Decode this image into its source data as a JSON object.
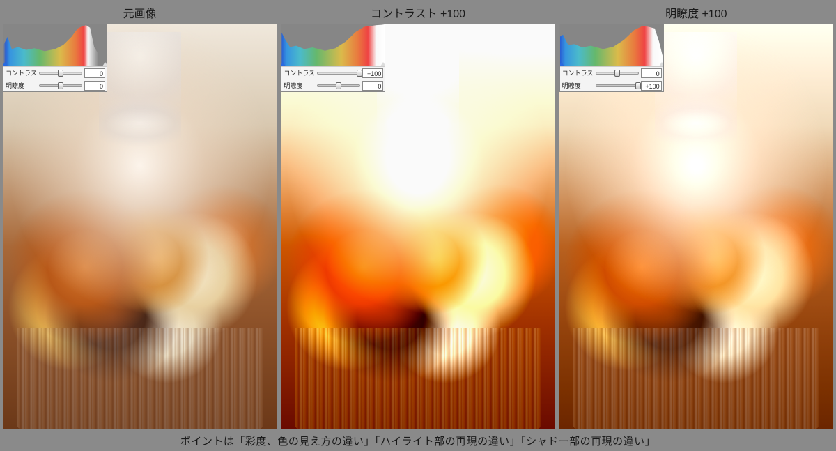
{
  "panels": [
    {
      "title": "元画像",
      "sliders": {
        "contrast": {
          "label": "コントラスト",
          "value": "0",
          "pos": 50
        },
        "clarity": {
          "label": "明瞭度",
          "value": "0",
          "pos": 50
        }
      }
    },
    {
      "title": "コントラスト +100",
      "sliders": {
        "contrast": {
          "label": "コントラスト",
          "value": "+100",
          "pos": 100
        },
        "clarity": {
          "label": "明瞭度",
          "value": "0",
          "pos": 50
        }
      }
    },
    {
      "title": "明瞭度 +100",
      "sliders": {
        "contrast": {
          "label": "コントラスト",
          "value": "0",
          "pos": 50
        },
        "clarity": {
          "label": "明瞭度",
          "value": "+100",
          "pos": 100
        }
      }
    }
  ],
  "caption": "ポイントは「彩度、色の見え方の違い」「ハイライト部の再現の違い」「シャドー部の再現の違い」"
}
